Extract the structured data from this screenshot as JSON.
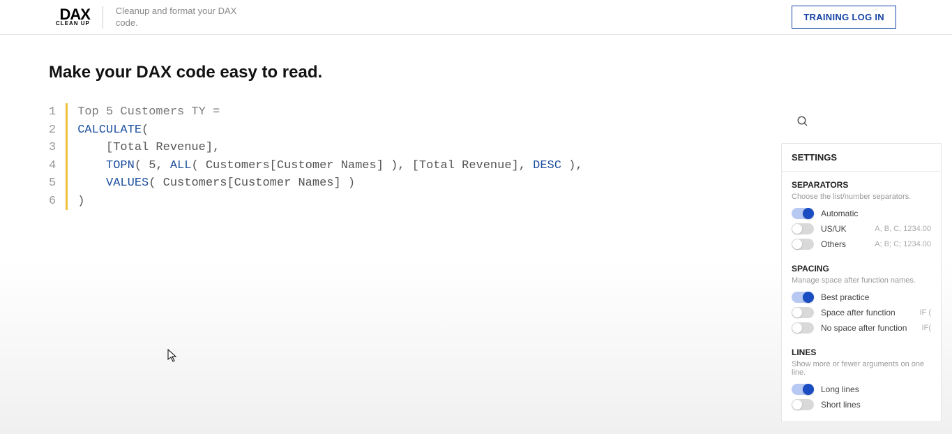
{
  "header": {
    "logo_main": "DAX",
    "logo_sub": "CLEAN UP",
    "tagline": "Cleanup and format your DAX code.",
    "training_btn": "TRAINING LOG IN"
  },
  "page_title": "Make your DAX code easy to read.",
  "code": {
    "lines": [
      "1",
      "2",
      "3",
      "4",
      "5",
      "6"
    ],
    "line1_name": "Top 5 Customers TY ",
    "line1_eq": "=",
    "line2_func": "CALCULATE",
    "line2_paren": "(",
    "line3_indent": "    ",
    "line3_measure": "[Total Revenue]",
    "line3_comma": ",",
    "line4_indent": "    ",
    "line4_topn": "TOPN",
    "line4_a": "( 5, ",
    "line4_all": "ALL",
    "line4_b": "( Customers[Customer Names] ), [Total Revenue], ",
    "line4_desc": "DESC",
    "line4_c": " ),",
    "line5_indent": "    ",
    "line5_values": "VALUES",
    "line5_a": "( Customers[Customer Names] )",
    "line6": ")"
  },
  "settings": {
    "title": "SETTINGS",
    "separators": {
      "title": "SEPARATORS",
      "desc": "Choose the list/number separators.",
      "options": [
        {
          "label": "Automatic",
          "hint": "",
          "on": true
        },
        {
          "label": "US/UK",
          "hint": "A, B, C, 1234.00",
          "on": false
        },
        {
          "label": "Others",
          "hint": "A; B; C; 1234.00",
          "on": false
        }
      ]
    },
    "spacing": {
      "title": "SPACING",
      "desc": "Manage space after function names.",
      "options": [
        {
          "label": "Best practice",
          "hint": "",
          "on": true
        },
        {
          "label": "Space after function",
          "hint": "IF (",
          "on": false
        },
        {
          "label": "No space after function",
          "hint": "IF(",
          "on": false
        }
      ]
    },
    "lines": {
      "title": "LINES",
      "desc": "Show more or fewer arguments on one line.",
      "options": [
        {
          "label": "Long lines",
          "hint": "",
          "on": true
        },
        {
          "label": "Short lines",
          "hint": "",
          "on": false
        }
      ]
    }
  }
}
